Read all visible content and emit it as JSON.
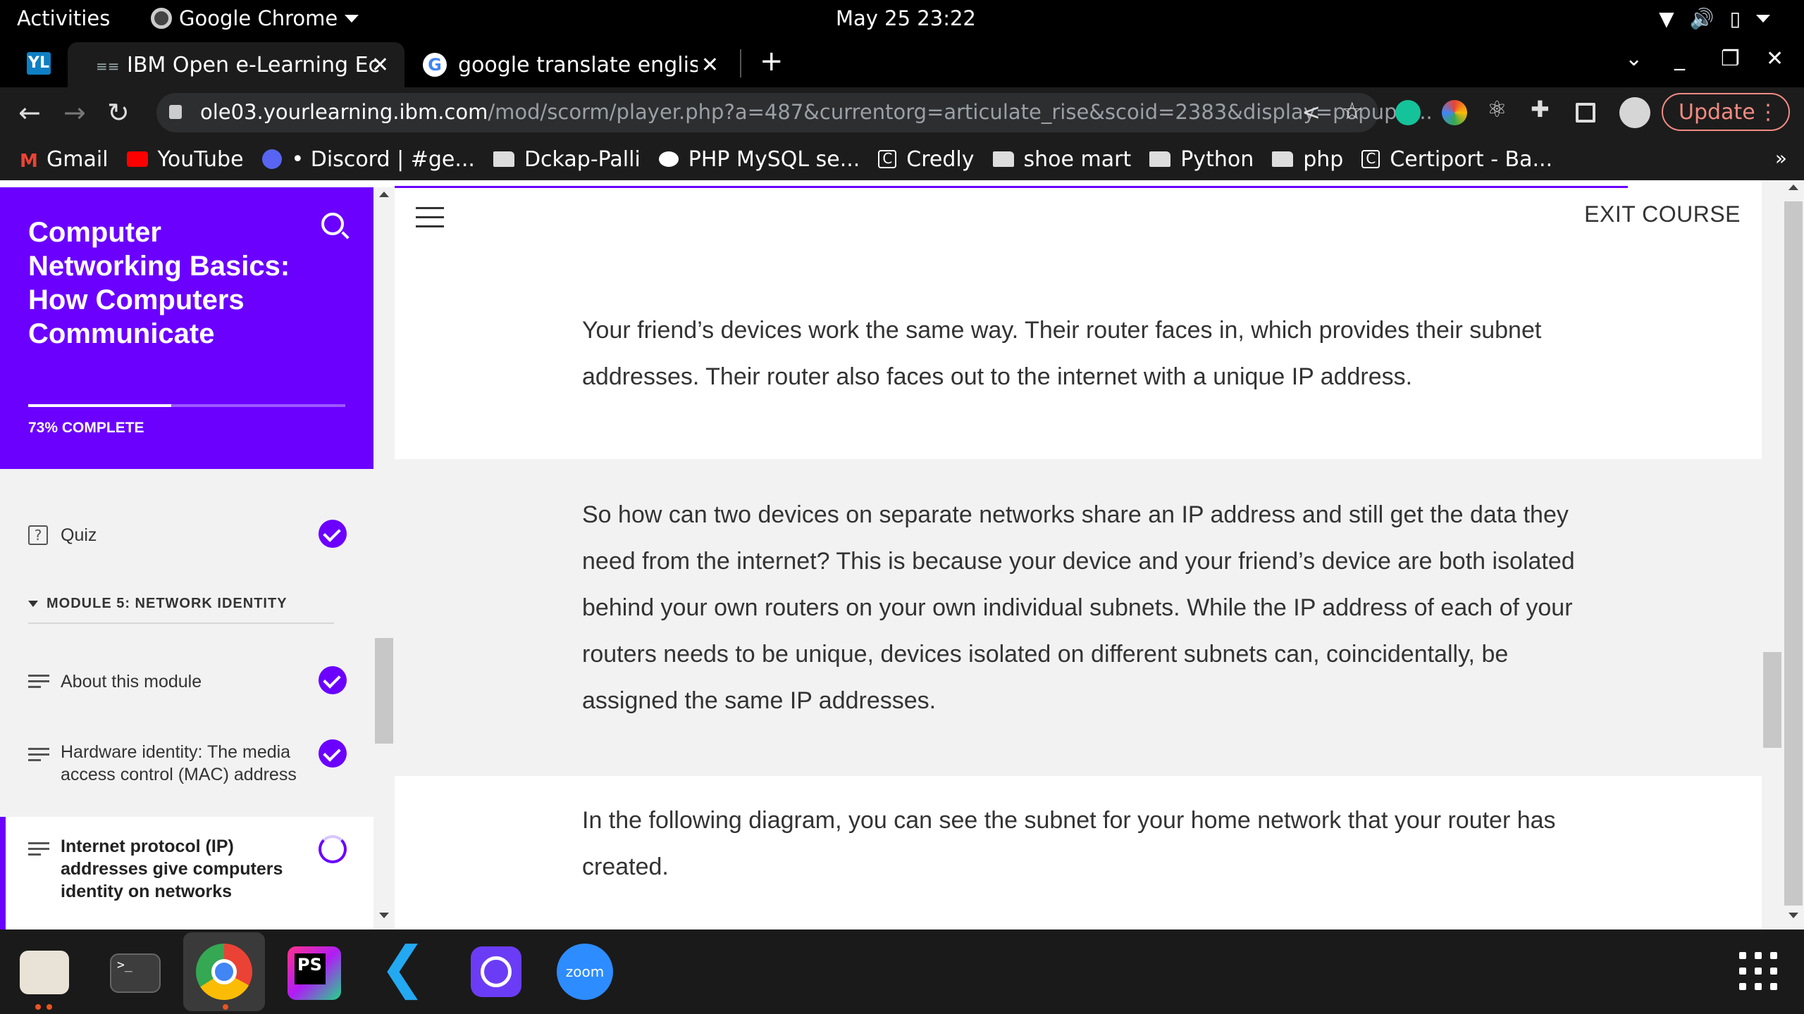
{
  "topbar": {
    "activities": "Activities",
    "app_name": "Google Chrome",
    "clock": "May 25  23:22"
  },
  "tabs": [
    {
      "title": "IBM Open e-Learning Eco",
      "favicon": "ibm-icon"
    },
    {
      "title": "google translate english t",
      "favicon": "google-icon"
    }
  ],
  "toolbar": {
    "url_host": "ole03.yourlearning.ibm.com",
    "url_path": "/mod/scorm/player.php?a=487&currentorg=articulate_rise&scoid=2383&display=popup&...",
    "update_label": "Update"
  },
  "bookmarks": [
    {
      "label": "Gmail",
      "icon": "gmail-icon",
      "color": "#ea4335"
    },
    {
      "label": "YouTube",
      "icon": "youtube-icon",
      "color": "#ff0000"
    },
    {
      "label": "• Discord | #ge...",
      "icon": "discord-icon",
      "color": "#5865f2"
    },
    {
      "label": "Dckap-Palli",
      "icon": "folder-icon",
      "color": "#dddddd"
    },
    {
      "label": "PHP MySQL se...",
      "icon": "medium-icon",
      "color": "#ffffff"
    },
    {
      "label": "Credly",
      "icon": "credly-icon",
      "color": "#ffffff"
    },
    {
      "label": "shoe mart",
      "icon": "folder-icon",
      "color": "#dddddd"
    },
    {
      "label": "Python",
      "icon": "folder-icon",
      "color": "#dddddd"
    },
    {
      "label": "php",
      "icon": "folder-icon",
      "color": "#dddddd"
    },
    {
      "label": "Certiport - Ba...",
      "icon": "credly-icon",
      "color": "#ffffff"
    }
  ],
  "course": {
    "title": "Computer Networking Basics: How Computers Communicate",
    "progress_label": "73% COMPLETE",
    "progress_fraction": 0.45,
    "lessons": [
      {
        "label": "Quiz",
        "status": "complete"
      },
      {
        "label": "About this module",
        "status": "complete"
      },
      {
        "label": "Hardware identity: The media access control (MAC) address",
        "status": "complete"
      },
      {
        "label": "Internet protocol (IP) addresses give computers identity on networks",
        "status": "in-progress"
      }
    ],
    "module_heading": "MODULE 5: NETWORK IDENTITY"
  },
  "main": {
    "exit_label": "EXIT COURSE",
    "paragraphs": [
      "Your friend’s devices work the same way. Their router faces in, which provides their subnet addresses. Their router also faces out to the internet with a unique IP address.",
      "So how can two devices on separate networks share an IP address and still get the data they need from the internet? This is because your device and your friend’s device are both isolated behind your own routers on your own individual subnets. While the IP address of each of your routers needs to be unique, devices isolated on different subnets can, coincidentally, be assigned the same IP addresses.",
      "In the following diagram, you can see the subnet for your home network that your router has created."
    ]
  },
  "dock": {
    "zoom_label": "zoom",
    "terminal_glyph": ">_",
    "phpstorm_label": "PS"
  },
  "colors": {
    "accent": "#6b00ff",
    "update_border": "#f28b82"
  }
}
